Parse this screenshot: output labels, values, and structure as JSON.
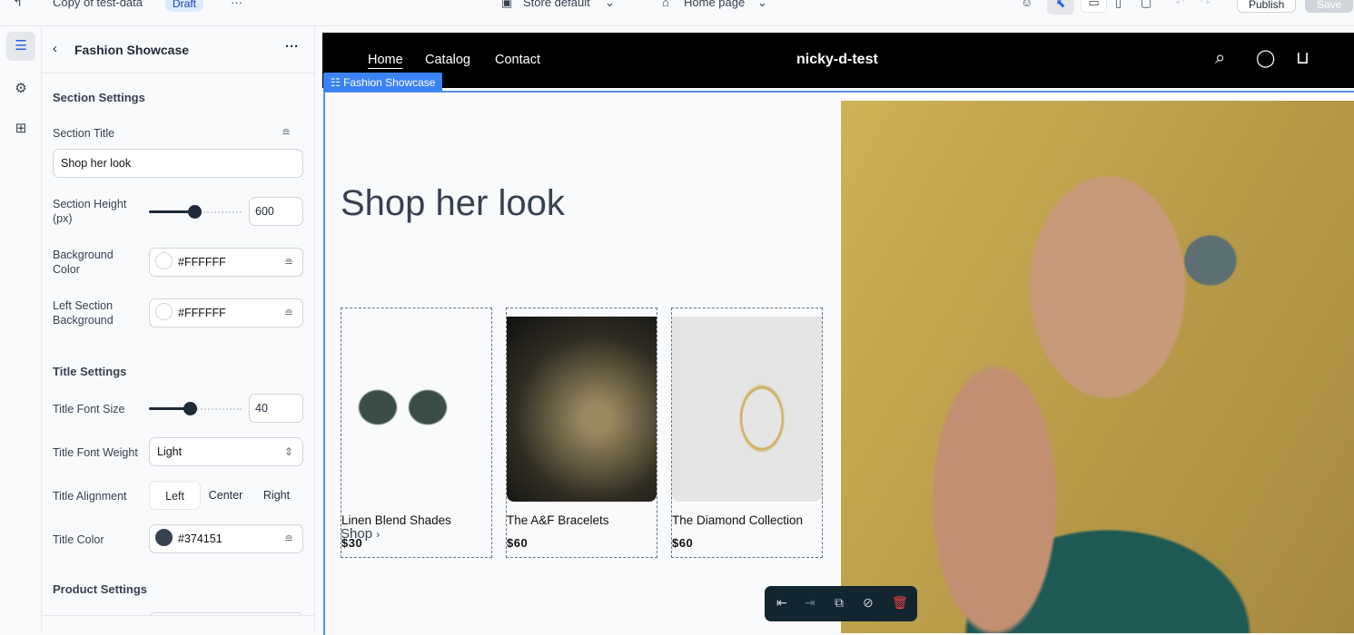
{
  "topbar": {
    "doc_name": "Copy of test-data",
    "status": "Draft",
    "more": "···",
    "store": "Store default",
    "page": "Home page",
    "publish": "Publish",
    "save": "Save"
  },
  "panel": {
    "title": "Fashion Showcase",
    "more": "···",
    "section_settings": "Section Settings",
    "section_title_label": "Section Title",
    "section_title_value": "Shop her look",
    "section_height_label": "Section Height (px)",
    "section_height_value": "600",
    "section_height_fraction": 0.5,
    "bg_color_label": "Background Color",
    "bg_color_value": "#FFFFFF",
    "left_bg_label": "Left Section Background",
    "left_bg_value": "#FFFFFF",
    "title_settings": "Title Settings",
    "title_font_size_label": "Title Font Size",
    "title_font_size_value": "40",
    "title_font_size_fraction": 0.45,
    "title_font_weight_label": "Title Font Weight",
    "title_font_weight_value": "Light",
    "title_alignment_label": "Title Alignment",
    "alignments": [
      "Left",
      "Center",
      "Right"
    ],
    "title_color_label": "Title Color",
    "title_color_value": "#374151",
    "product_settings": "Product Settings"
  },
  "store": {
    "nav": [
      "Home",
      "Catalog",
      "Contact"
    ],
    "brand": "nicky-d-test",
    "section_tag": "Fashion Showcase",
    "heading": "Shop her look",
    "shop_link": "Shop",
    "products": [
      {
        "name": "Linen Blend Shades",
        "price": "$30"
      },
      {
        "name": "The A&F Bracelets",
        "price": "$60"
      },
      {
        "name": "The Diamond Collection",
        "price": "$60"
      }
    ]
  },
  "colors": {
    "accent": "#3b82f6",
    "title": "#374151",
    "delete": "#ef4444"
  }
}
